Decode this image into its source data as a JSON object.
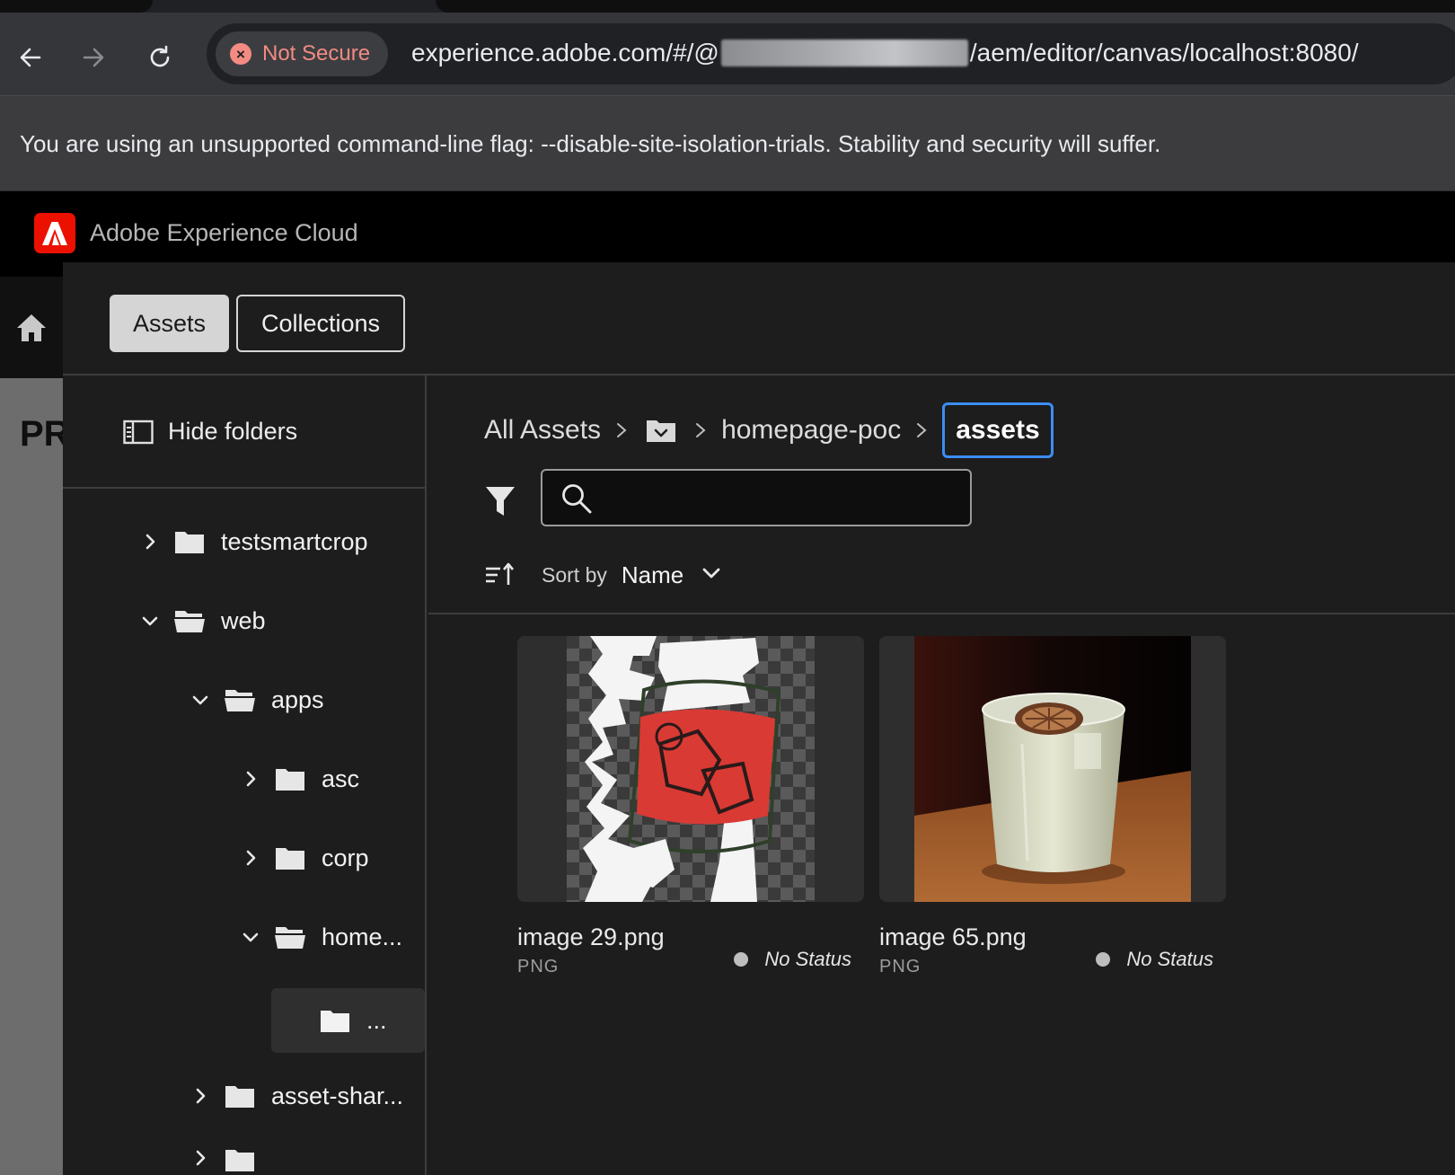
{
  "browser": {
    "security_label": "Not Secure",
    "url_prefix": "experience.adobe.com/#/@",
    "url_suffix": "/aem/editor/canvas/localhost:8080/",
    "infobar_message": "You are using an unsupported command-line flag: --disable-site-isolation-trials. Stability and security will suffer."
  },
  "shell": {
    "title": "Adobe Experience Cloud",
    "page_title_fragment": "PR"
  },
  "selector": {
    "toggles": {
      "assets": "Assets",
      "collections": "Collections"
    },
    "hide_folders_label": "Hide folders",
    "tree": [
      {
        "label": "testsmartcrop",
        "state": "collapsed",
        "depth": 0
      },
      {
        "label": "web",
        "state": "expanded",
        "depth": 0
      },
      {
        "label": "apps",
        "state": "expanded",
        "depth": 1
      },
      {
        "label": "asc",
        "state": "collapsed",
        "depth": 2
      },
      {
        "label": "corp",
        "state": "collapsed",
        "depth": 2
      },
      {
        "label": "home...",
        "state": "expanded",
        "depth": 2
      },
      {
        "label": "...",
        "state": "selected",
        "depth": 3
      },
      {
        "label": "asset-shar...",
        "state": "collapsed",
        "depth": 1
      }
    ],
    "breadcrumb": {
      "root": "All Assets",
      "parent": "homepage-poc",
      "current": "assets"
    },
    "search": {
      "placeholder": "",
      "value": ""
    },
    "sort": {
      "label": "Sort by",
      "value": "Name"
    },
    "assets": [
      {
        "name": "image 29.png",
        "type": "PNG",
        "status": "No Status"
      },
      {
        "name": "image 65.png",
        "type": "PNG",
        "status": "No Status"
      }
    ]
  },
  "colors": {
    "adobe_red": "#eb1000",
    "focus_blue": "#3b8df5",
    "not_secure_red": "#f28b82"
  }
}
